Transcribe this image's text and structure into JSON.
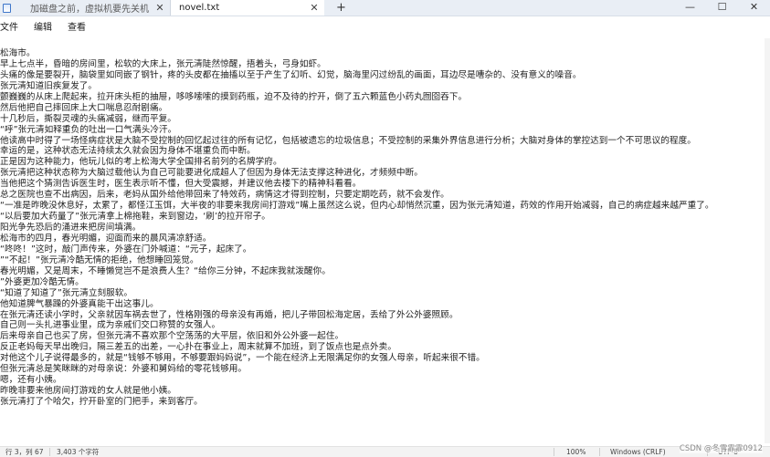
{
  "tabs": [
    {
      "title": "加磁盘之前，虚拟机要先关机"
    },
    {
      "title": "novel.txt"
    }
  ],
  "new_tab_symbol": "+",
  "window_controls": {
    "minimize": "—",
    "maximize": "☐",
    "close": "✕"
  },
  "menu": [
    "文件",
    "编辑",
    "查看"
  ],
  "document": {
    "lines": [
      "松海市。",
      "早上七点半，昏暗的房间里，松软的大床上，张元清陡然惊醒，捂着头，弓身如虾。",
      "头痛的像是要裂开，脑袋里如同嵌了钢针，疼的头皮都在抽搐以至于产生了幻听、幻觉，脑海里闪过纷乱的画面，耳边尽是嘈杂的、没有意义的噪音。",
      "张元清知道旧疾复发了。",
      "颤巍巍的从床上爬起来，拉开床头柜的抽屉，哆哆嗦嗦的摸到药瓶，迫不及待的拧开，倒了五六颗蓝色小药丸囫囵吞下。",
      "然后他把自己摔回床上大口喘息忍耐剧痛。",
      "十几秒后，撕裂灵魂的头痛减弱，继而平复。",
      "“呼”张元清如释重负的吐出一口气满头冷汗。",
      "他读高中时得了一场怪病症状是大脑不受控制的回忆起过往的所有记忆，包括被遗忘的垃圾信息；不受控制的采集外界信息进行分析；大脑对身体的掌控达到一个不可思议的程度。",
      "幸运的是，这种状态无法持续太久就会因为身体不堪重负而中断。",
      "正是因为这种能力，他玩儿似的考上松海大学全国排名前列的名牌学府。",
      "张元清把这种状态称为大脑过载他认为自己可能要进化成超人了但因为身体无法支撑这种进化，才频频中断。",
      "当他把这个猜测告诉医生时，医生表示听不懂，但大受震撼，并建议他去楼下的精神科看看。",
      "总之医院也查不出病因，后来，老妈从国外给他带回来了特效药，病情这才得到控制，只要定期吃药，就不会发作。",
      "“一准是昨晚没休息好，太累了，都怪江玉饵，大半夜的非要来我房间打游戏”嘴上虽然这么说，但内心却悄然沉重，因为张元清知道，药效的作用开始减弱，自己的病症越来越严重了。",
      "“以后要加大药量了”张元清拿上棉拖鞋，来到窗边，‘刷’的拉开帘子。",
      "阳光争先恐后的涌进来把房间填满。",
      "松海市的四月，春光明媚，迎面而来的晨风清凉舒适。",
      "“咚咚！”这时，敲门声传来，外婆在门外喊道：“元子，起床了。",
      "”“不起！”张元清冷酷无情的拒绝，他想睡回笼觉。",
      "春光明媚，又是周末，不睡懒觉岂不是浪费人生？“给你三分钟，不起床我就泼醒你。",
      "”外婆更加冷酷无情。",
      "“知道了知道了”张元清立刻服软。",
      "他知道脾气暴躁的外婆真能干出这事儿。",
      "在张元清还读小学时，父亲就因车祸去世了，性格刚强的母亲没有再婚，把儿子带回松海定居，丢给了外公外婆照顾。",
      "自己则一头扎进事业里，成为亲戚们交口称赞的女强人。",
      "后来母亲自己也买了房，但张元清不喜欢那个空荡荡的大平层，依旧和外公外婆一起住。",
      "反正老妈每天早出晚归，隔三差五的出差，一心扑在事业上，周末就算不加班，到了饭点也是点外卖。",
      "对他这个儿子说得最多的，就是“钱够不够用，不够要跟妈妈说”，一个能在经济上无限满足你的女强人母亲，听起来很不错。",
      "但张元清总是笑眯眯的对母亲说：外婆和舅妈给的零花钱够用。",
      "嗯，还有小姨。",
      "昨晚非要来他房间打游戏的女人就是他小姨。",
      "张元清打了个哈欠，拧开卧室的门把手，来到客厅。"
    ]
  },
  "status_bar": {
    "position": "行 3，列 67",
    "char_count": "3,403 个字符",
    "zoom": "100%",
    "line_ending": "Windows (CRLF)",
    "encoding": "UTF-8"
  },
  "watermark": "CSDN @冬雪霏霏0912"
}
